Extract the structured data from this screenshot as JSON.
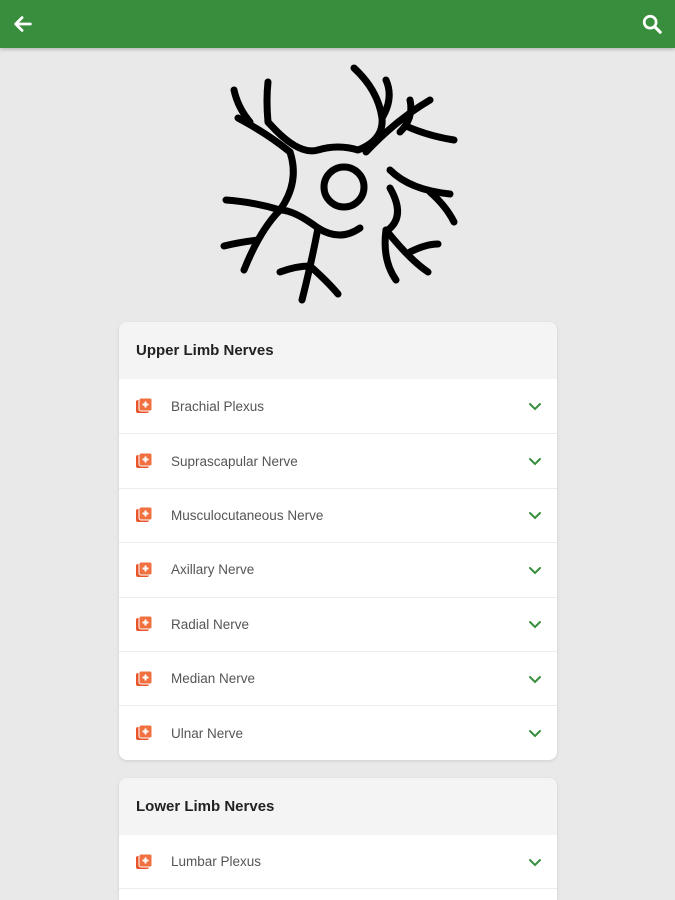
{
  "appbar": {
    "back_icon": "arrow-left-icon",
    "search_icon": "search-icon",
    "color": "#388e3c"
  },
  "hero": {
    "icon": "neuron-icon"
  },
  "sections": [
    {
      "title": "Upper Limb Nerves",
      "items": [
        {
          "label": "Brachial Plexus"
        },
        {
          "label": "Suprascapular Nerve"
        },
        {
          "label": "Musculocutaneous Nerve"
        },
        {
          "label": "Axillary Nerve"
        },
        {
          "label": "Radial Nerve"
        },
        {
          "label": "Median Nerve"
        },
        {
          "label": "Ulnar Nerve"
        }
      ]
    },
    {
      "title": "Lower Limb Nerves",
      "items": [
        {
          "label": "Lumbar Plexus"
        }
      ]
    }
  ],
  "colors": {
    "item_icon": "#e8552b",
    "chevron": "#388e3c"
  }
}
